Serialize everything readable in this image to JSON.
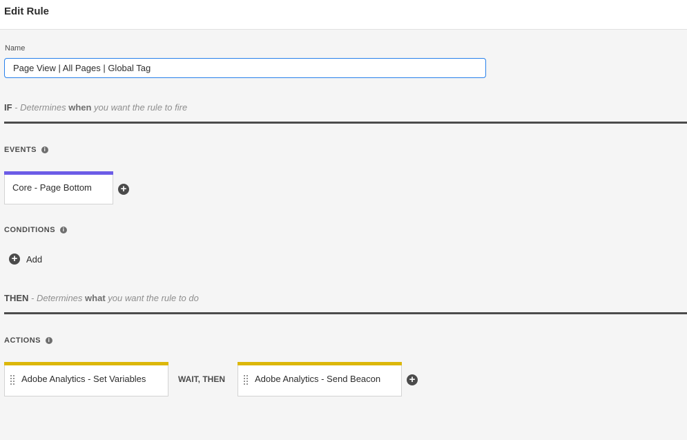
{
  "header": {
    "title": "Edit Rule"
  },
  "name_field": {
    "label": "Name",
    "value": "Page View | All Pages | Global Tag"
  },
  "if_section": {
    "keyword": "IF",
    "prefix": " - Determines ",
    "emphasis": "when",
    "suffix": " you want the rule to fire"
  },
  "events": {
    "label": "EVENTS",
    "items": [
      {
        "label": "Core - Page Bottom",
        "accent_color": "#6c5ce7"
      }
    ]
  },
  "conditions": {
    "label": "CONDITIONS",
    "add_label": "Add"
  },
  "then_section": {
    "keyword": "THEN",
    "prefix": " - Determines ",
    "emphasis": "what",
    "suffix": " you want the rule to do"
  },
  "actions": {
    "label": "ACTIONS",
    "items": [
      {
        "label": "Adobe Analytics - Set Variables",
        "accent_color": "#dcb70a"
      },
      {
        "label": "Adobe Analytics - Send Beacon",
        "accent_color": "#dcb70a"
      }
    ],
    "connector": "WAIT, THEN"
  },
  "colors": {
    "accent_input_border": "#2680eb",
    "rule_line": "#4b4b4b"
  },
  "icons": {
    "info": "info-icon",
    "add": "plus-circle-icon",
    "drag": "drag-handle-icon"
  }
}
